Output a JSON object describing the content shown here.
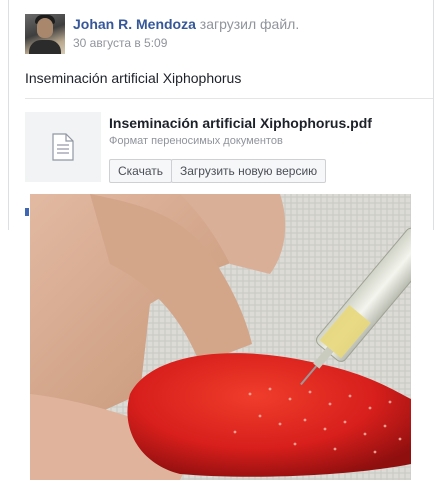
{
  "post": {
    "author": "Johan R. Mendoza",
    "action": "загрузил файл.",
    "timestamp": "30 августа в 5:09",
    "text": "Inseminación artificial Xiphophorus"
  },
  "attachment": {
    "file_name": "Inseminación artificial Xiphophorus.pdf",
    "file_type": "Формат переносимых документов",
    "icon": "document-icon",
    "download_label": "Скачать",
    "upload_label": "Загрузить новую версию"
  },
  "colors": {
    "author_link": "#365899",
    "secondary_text": "#90949c",
    "fish_body": "#d81f1c"
  }
}
